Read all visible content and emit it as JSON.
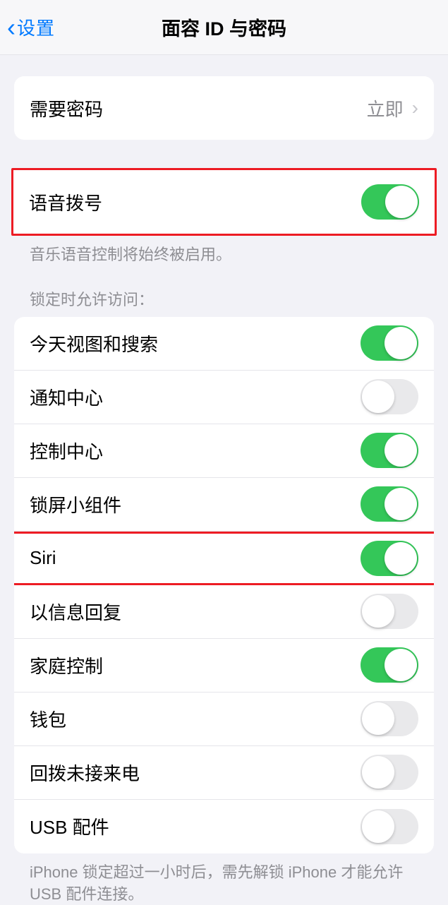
{
  "header": {
    "back_label": "设置",
    "title": "面容 ID 与密码"
  },
  "passcode_section": {
    "require_passcode_label": "需要密码",
    "require_passcode_value": "立即"
  },
  "voice_dial_section": {
    "label": "语音拨号",
    "enabled": true,
    "footer": "音乐语音控制将始终被启用。"
  },
  "lock_access": {
    "header": "锁定时允许访问：",
    "items": [
      {
        "label": "今天视图和搜索",
        "enabled": true,
        "highlighted": false
      },
      {
        "label": "通知中心",
        "enabled": false,
        "highlighted": false
      },
      {
        "label": "控制中心",
        "enabled": true,
        "highlighted": false
      },
      {
        "label": "锁屏小组件",
        "enabled": true,
        "highlighted": false
      },
      {
        "label": "Siri",
        "enabled": true,
        "highlighted": true
      },
      {
        "label": "以信息回复",
        "enabled": false,
        "highlighted": false
      },
      {
        "label": "家庭控制",
        "enabled": true,
        "highlighted": false
      },
      {
        "label": "钱包",
        "enabled": false,
        "highlighted": false
      },
      {
        "label": "回拨未接来电",
        "enabled": false,
        "highlighted": false
      },
      {
        "label": "USB 配件",
        "enabled": false,
        "highlighted": false
      }
    ],
    "footer": "iPhone 锁定超过一小时后，需先解锁 iPhone 才能允许 USB 配件连接。"
  }
}
